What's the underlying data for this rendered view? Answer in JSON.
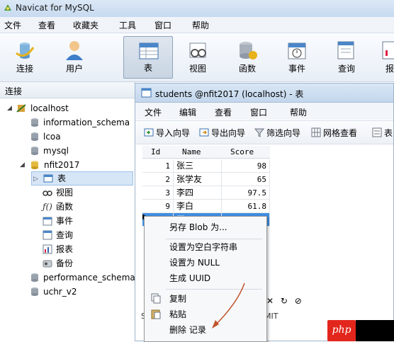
{
  "app": {
    "title": "Navicat for MySQL"
  },
  "menubar": {
    "items": [
      "文件",
      "查看",
      "收藏夹",
      "工具",
      "窗口",
      "帮助"
    ]
  },
  "toolbar": {
    "items": [
      "连接",
      "用户",
      "表",
      "视图",
      "函数",
      "事件",
      "查询",
      "报"
    ]
  },
  "left_panel": {
    "header": "连接",
    "tree": [
      {
        "label": "localhost",
        "icon": "server-icon"
      },
      {
        "label": "information_schema",
        "icon": "database-icon"
      },
      {
        "label": "lcoa",
        "icon": "database-icon"
      },
      {
        "label": "mysql",
        "icon": "database-icon"
      },
      {
        "label": "nfit2017",
        "icon": "database-open-icon"
      },
      {
        "label": "表",
        "icon": "table-icon"
      },
      {
        "label": "视图",
        "icon": "view-icon"
      },
      {
        "label": "函数",
        "icon": "function-icon"
      },
      {
        "label": "事件",
        "icon": "event-icon"
      },
      {
        "label": "查询",
        "icon": "query-icon"
      },
      {
        "label": "报表",
        "icon": "report-icon"
      },
      {
        "label": "备份",
        "icon": "backup-icon"
      },
      {
        "label": "performance_schema",
        "icon": "database-icon"
      },
      {
        "label": "uchr_v2",
        "icon": "database-icon"
      }
    ]
  },
  "child_window": {
    "title": "students @nfit2017 (localhost) - 表",
    "menu": [
      "文件",
      "编辑",
      "查看",
      "窗口",
      "帮助"
    ],
    "toolbar": [
      "导入向导",
      "导出向导",
      "筛选向导",
      "网格查看",
      "表"
    ],
    "columns": [
      "Id",
      "Name",
      "Score"
    ],
    "rows": [
      [
        "1",
        "张三",
        "98"
      ],
      [
        "2",
        "张学友",
        "65"
      ],
      [
        "3",
        "李四",
        "97.5"
      ],
      [
        "9",
        "李白",
        "61.8"
      ],
      [
        "10",
        "王五",
        "1"
      ]
    ],
    "status_fragment": "MIT"
  },
  "context_menu": {
    "items": [
      "另存 Blob 为...",
      "设置为空白字符串",
      "设置为 NULL",
      "生成 UUID",
      "复制",
      "粘贴",
      "删除 记录"
    ]
  },
  "watermark": "php",
  "colors": {
    "selection": "#3e8de0",
    "window_title": "#c7daf0",
    "arrow": "#c0522a",
    "badge_red": "#e2261c"
  }
}
